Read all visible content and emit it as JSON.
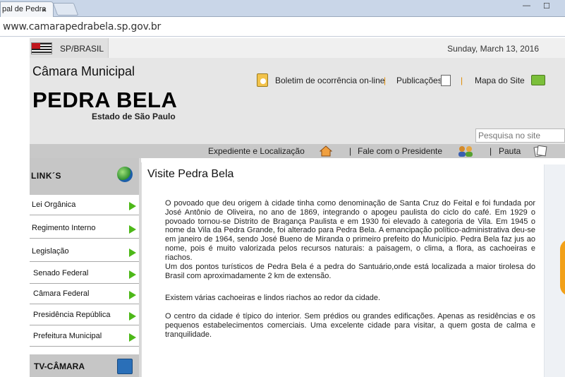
{
  "browser": {
    "tab_title": "pal de Pedra",
    "tab_close": "×",
    "window_min": "—",
    "window_max": "☐",
    "url": "www.camarapedrabela.sp.gov.br"
  },
  "header": {
    "state_label": "SP/BRASIL",
    "date": "Sunday, March 13, 2016",
    "org_name": "Câmara Municipal",
    "city": "PEDRA BELA",
    "state": "Estado de São Paulo",
    "top_links": {
      "boletim": "Boletim de ocorrência on-line",
      "publicacoes": "Publicações",
      "mapa": "Mapa do Site",
      "separator": "|"
    },
    "search_placeholder": "Pesquisa no site"
  },
  "nav": {
    "expediente": "Expediente e Localização",
    "fale": "Fale com o Presidente",
    "pauta": "Pauta",
    "separator": "|"
  },
  "sidebar": {
    "links_title": "LINK´S",
    "items": [
      {
        "label": "Lei Orgânica"
      },
      {
        "label": "Regimento Interno"
      },
      {
        "label": "Legislação"
      },
      {
        "label": "Senado Federal"
      },
      {
        "label": "Câmara Federal"
      },
      {
        "label": "Presidência República"
      },
      {
        "label": "Prefeitura Municipal"
      }
    ],
    "tv_title": "TV-CÂMARA"
  },
  "main": {
    "title": "Visite Pedra Bela",
    "paragraphs": [
      "O povoado que deu origem à cidade tinha como denominação de Santa Cruz do Feital e foi fundada por José Antônio de Oliveira, no ano de 1869, integrando o apogeu paulista do ciclo do café. Em 1929 o povoado tornou-se Distrito de Bragança Paulista e em 1930 foi elevado à categoria de Vila. Em 1945 o nome da Vila da Pedra Grande, foi alterado para Pedra Bela. A emancipação político-administrativa deu-se em janeiro de 1964, sendo José Bueno de Miranda o primeiro prefeito do Município. Pedra Bela faz jus ao nome, pois é muito valorizada pelos recursos naturais: a paisagem, o clima, a flora, as cachoeiras e riachos.",
      "Um dos pontos turísticos de Pedra Bela é a pedra do Santuário,onde está localizada a maior tirolesa do Brasil com aproximadamente 2 km de extensão.",
      "Existem várias cachoeiras e lindos riachos ao redor da cidade.",
      "O centro da cidade é típico do interior. Sem prédios ou grandes edificações. Apenas as residências e os pequenos estabelecimentos comerciais. Uma excelente cidade para visitar, a quem gosta de calma e tranquilidade."
    ]
  },
  "colors": {
    "arrow": "#4db818",
    "separator": "#e08a00",
    "header_bg": "#e6e6e6",
    "nav_bg": "#c8c8c8"
  }
}
